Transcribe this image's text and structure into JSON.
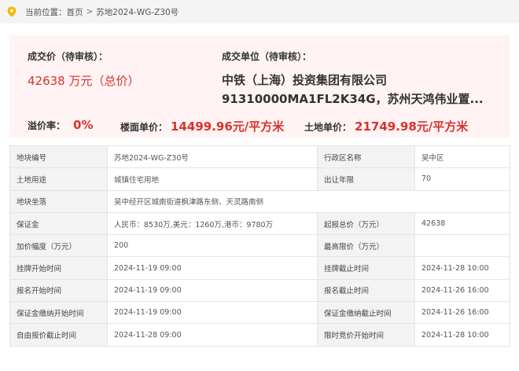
{
  "breadcrumb": {
    "prefix": "当前位置：",
    "home": "首页",
    "separator": ">",
    "current": "苏地2024-WG-Z30号"
  },
  "summary": {
    "price_label": "成交价（待审核）：",
    "price_value": "42638 万元（总价）",
    "unit_label": "成交单位（待审核）：",
    "unit_line1": "中铁（上海）投资集团有限公司",
    "unit_line2": "91310000MA1FL2K34G，苏州天鸿伟业置...",
    "premium_label": "溢价率：",
    "premium_value": "0%",
    "floor_price_label": "楼面单价：",
    "floor_price_value": "14499.96元/平方米",
    "land_price_label": "土地单价：",
    "land_price_value": "21749.98元/平方米"
  },
  "details": [
    {
      "k1": "地块编号",
      "v1": "苏地2024-WG-Z30号",
      "k2": "行政区名称",
      "v2": "吴中区"
    },
    {
      "k1": "土地用途",
      "v1": "城镇住宅用地",
      "k2": "出让年限",
      "v2": "70"
    },
    {
      "k1": "地块坐落",
      "v1": "吴中经开区城南街道枫津路东侧、天灵路南侧"
    },
    {
      "k1": "保证金",
      "v1": "人民币：8530万,美元：1260万,港币：9780万",
      "k2": "起报总价（万元）",
      "v2": "42638"
    },
    {
      "k1": "加价幅度（万元）",
      "v1": "200",
      "k2": "最高限价（万元）",
      "v2": ""
    },
    {
      "k1": "挂牌开始时间",
      "v1": "2024-11-19 09:00",
      "k2": "挂牌截止时间",
      "v2": "2024-11-28 10:00"
    },
    {
      "k1": "报名开始时间",
      "v1": "2024-11-19 09:00",
      "k2": "报名截止时间",
      "v2": "2024-11-26 16:00"
    },
    {
      "k1": "保证金缴纳开始时间",
      "v1": "2024-11-19 09:00",
      "k2": "保证金缴纳截止时间",
      "v2": "2024-11-26 16:00"
    },
    {
      "k1": "自由报价截止时间",
      "v1": "2024-11-28 09:00",
      "k2": "限时竞价开始时间",
      "v2": "2024-11-28 10:00"
    }
  ],
  "colors": {
    "accent_red": "#d9322c",
    "icon_orange": "#f7b500",
    "summary_bg": "#fff3f3"
  },
  "icons": {
    "location": "location-pin-icon"
  }
}
